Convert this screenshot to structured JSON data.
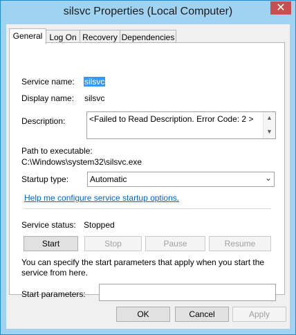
{
  "window": {
    "title": "silsvc Properties (Local Computer)",
    "close_glyph": "✕"
  },
  "tabs": [
    {
      "label": "General"
    },
    {
      "label": "Log On"
    },
    {
      "label": "Recovery"
    },
    {
      "label": "Dependencies"
    }
  ],
  "general": {
    "service_name_label": "Service name:",
    "service_name_value": "silsvc",
    "display_name_label": "Display name:",
    "display_name_value": "silsvc",
    "description_label": "Description:",
    "description_value": "<Failed to Read Description. Error Code: 2 >",
    "path_label": "Path to executable:",
    "path_value": "C:\\Windows\\system32\\silsvc.exe",
    "startup_type_label": "Startup type:",
    "startup_type_value": "Automatic",
    "help_link": "Help me configure service startup options.",
    "status_label": "Service status:",
    "status_value": "Stopped",
    "start_button": "Start",
    "stop_button": "Stop",
    "pause_button": "Pause",
    "resume_button": "Resume",
    "params_info": "You can specify the start parameters that apply when you start the service from here.",
    "params_label": "Start parameters:",
    "params_value": ""
  },
  "footer": {
    "ok": "OK",
    "cancel": "Cancel",
    "apply": "Apply"
  },
  "colors": {
    "frame": "#9fd3f1",
    "close": "#c74f4f",
    "selection": "#3399ff",
    "link": "#0066cc"
  }
}
